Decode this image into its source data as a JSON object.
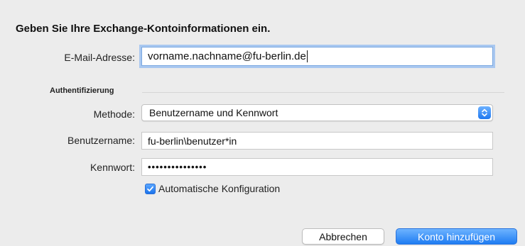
{
  "dialog": {
    "heading": "Geben Sie Ihre Exchange-Kontoinformationen ein."
  },
  "email": {
    "label": "E-Mail-Adresse:",
    "value": "vorname.nachname@fu-berlin.de"
  },
  "auth_section": {
    "title": "Authentifizierung"
  },
  "method": {
    "label": "Methode:",
    "selected": "Benutzername und Kennwort",
    "icon": "updown-arrows-icon"
  },
  "username": {
    "label": "Benutzername:",
    "value": "fu-berlin\\benutzer*in"
  },
  "password": {
    "label": "Kennwort:",
    "value_masked": "•••••••••••••••"
  },
  "auto_config": {
    "label": "Automatische Konfiguration",
    "checked": true
  },
  "buttons": {
    "cancel": "Abbrechen",
    "add_account": "Konto hinzufügen"
  },
  "colors": {
    "accent": "#1f7cf2",
    "background": "#ececec"
  }
}
